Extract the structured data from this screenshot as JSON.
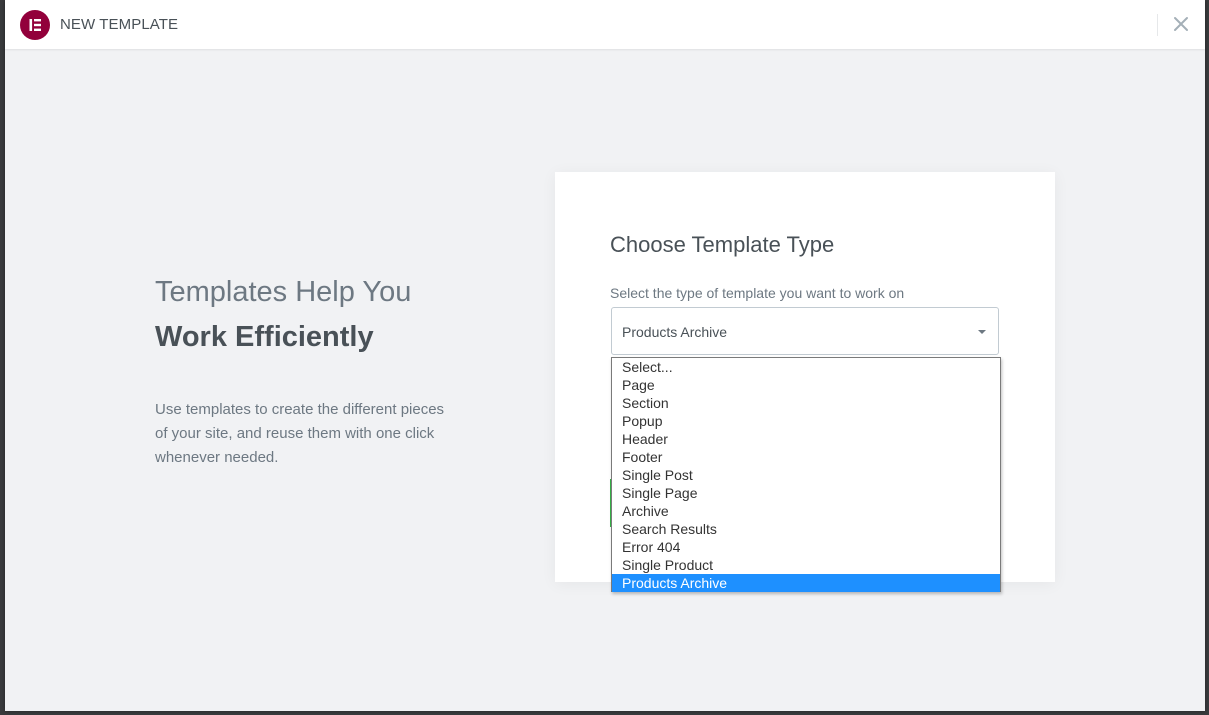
{
  "header": {
    "title": "NEW TEMPLATE",
    "logo_icon": "elementor-logo-icon",
    "close_icon": "close-icon",
    "brand_color": "#92003b"
  },
  "intro": {
    "title_line1": "Templates Help You",
    "title_line2": "Work Efficiently",
    "description": "Use templates to create the different pieces of your site, and reuse them with one click whenever needed."
  },
  "form": {
    "title": "Choose Template Type",
    "select_label": "Select the type of template you want to work on",
    "selected_value": "Products Archive",
    "options": [
      "Select...",
      "Page",
      "Section",
      "Popup",
      "Header",
      "Footer",
      "Single Post",
      "Single Page",
      "Archive",
      "Search Results",
      "Error 404",
      "Single Product",
      "Products Archive"
    ],
    "highlight_color": "#1e90ff"
  }
}
